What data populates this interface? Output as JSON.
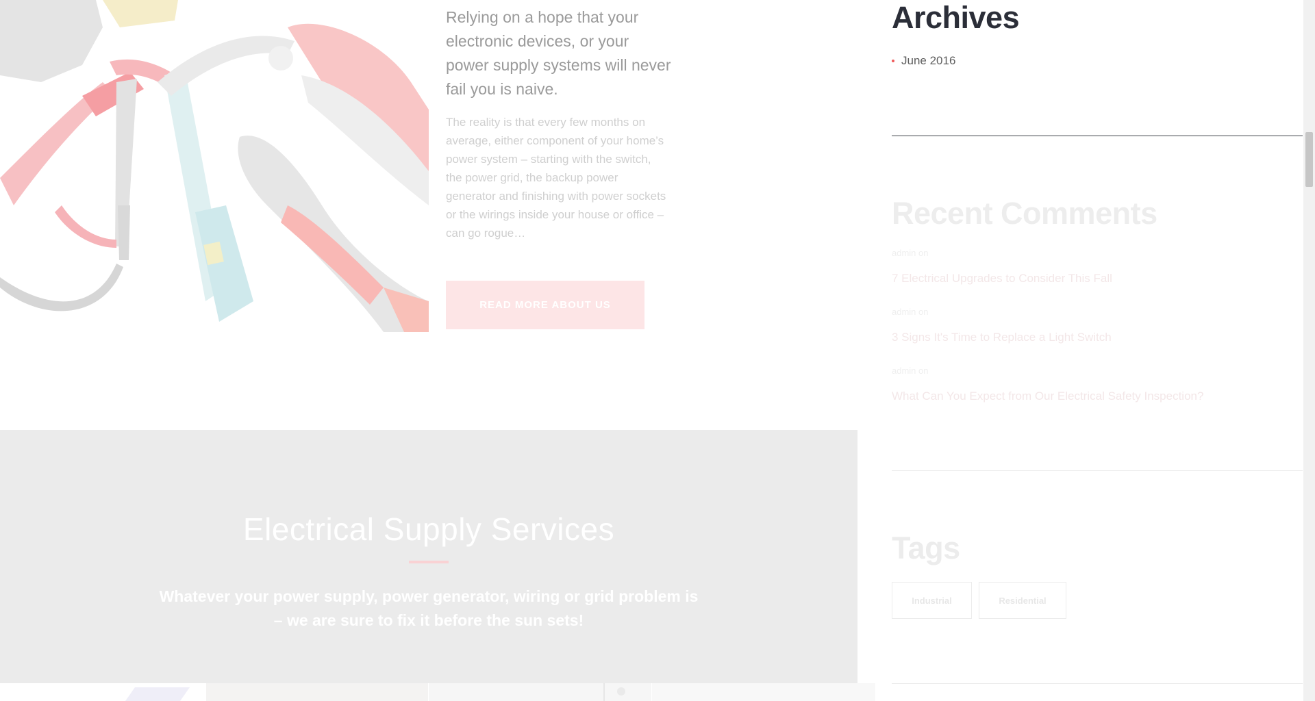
{
  "about": {
    "lead": "Relying on a hope that your electronic devices, or your power supply systems will never fail you is naive.",
    "body": "The reality is that every few months on average, either component of your home’s power system – starting with the switch, the power grid, the backup power generator and finishing with power sockets or the wirings inside your house or office – can go rogue…",
    "button_label": "READ MORE ABOUT US"
  },
  "services": {
    "title": "Electrical Supply Services",
    "subtitle": "Whatever your power supply, power generator, wiring or grid problem is – we are sure to fix it before the sun sets!"
  },
  "sidebar": {
    "archives": {
      "title": "Archives",
      "items": [
        {
          "label": "June 2016"
        }
      ]
    },
    "recent_comments": {
      "title": "Recent Comments",
      "items": [
        {
          "author": "admin",
          "connector": "on",
          "post": "7 Electrical Upgrades to Consider This Fall"
        },
        {
          "author": "admin",
          "connector": "on",
          "post": "3 Signs It's Time to Replace a Light Switch"
        },
        {
          "author": "admin",
          "connector": "on",
          "post": "What Can You Expect from Our Electrical Safety Inspection?"
        }
      ]
    },
    "tags": {
      "title": "Tags",
      "items": [
        {
          "label": "Industrial"
        },
        {
          "label": "Residential"
        }
      ]
    }
  },
  "colors": {
    "accent": "#ef5b5b",
    "heading": "#2b2e38",
    "services_bg": "#ebebeb"
  }
}
